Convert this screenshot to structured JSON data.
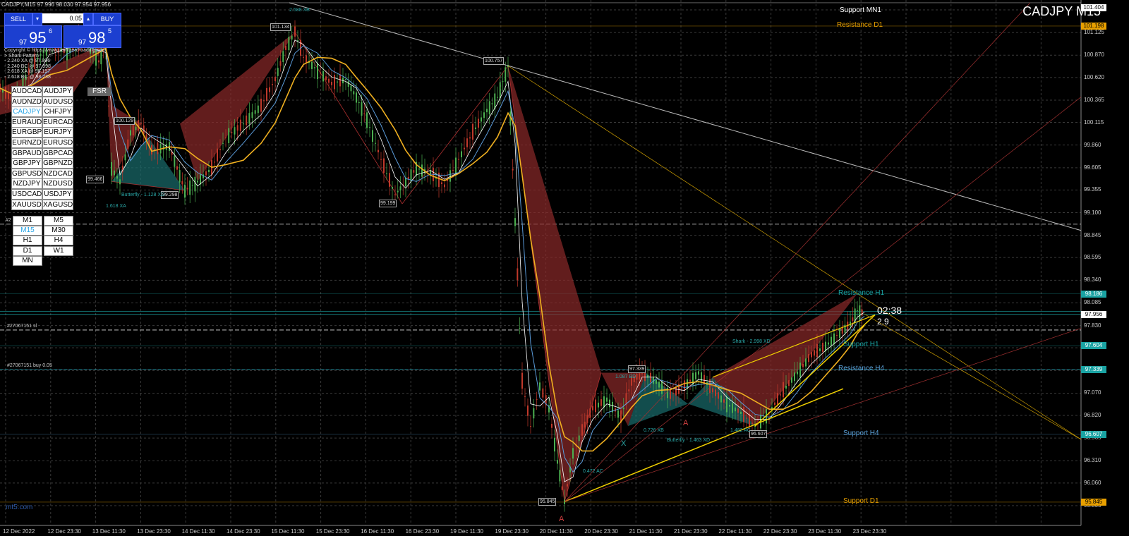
{
  "window": {
    "title": "CADJPY,M15  97.996 98.030 97.954 97.956",
    "symbol_label": "CADJPY M15"
  },
  "trade_panel": {
    "sell_label": "SELL",
    "buy_label": "BUY",
    "lot_value": "0.05",
    "bid_prefix": "97",
    "bid_main": "95",
    "bid_sup": "6",
    "ask_prefix": "97",
    "ask_main": "98",
    "ask_sup": "5"
  },
  "info_lines": [
    "Copyright © https://www.pointzero-trading.com",
    "> Shark Pattern",
    "- 2.240 XA @ 97.996",
    "- 2.240 BC @ 97.998",
    "- 2.618 XA @ 98.197",
    "- 2.618 BC @ 98.238"
  ],
  "pairs": [
    [
      "AUDCAD",
      "AUDJPY"
    ],
    [
      "AUDNZD",
      "AUDUSD"
    ],
    [
      "CADJPY",
      "CHFJPY"
    ],
    [
      "EURAUD",
      "EURCAD"
    ],
    [
      "EURGBP",
      "EURJPY"
    ],
    [
      "EURNZD",
      "EURUSD"
    ],
    [
      "GBPAUD",
      "GBPCAD"
    ],
    [
      "GBPJPY",
      "GBPNZD"
    ],
    [
      "GBPUSD",
      "NZDCAD"
    ],
    [
      "NZDJPY",
      "NZDUSD"
    ],
    [
      "USDCAD",
      "USDJPY"
    ],
    [
      "XAUUSD",
      "XAGUSD"
    ]
  ],
  "active_pair": "CADJPY",
  "fsr_label": "FSR",
  "timeframes": [
    [
      "M1",
      "M5"
    ],
    [
      "M15",
      "M30"
    ],
    [
      "H1",
      "H4"
    ],
    [
      "D1",
      "W1"
    ],
    [
      "MN"
    ]
  ],
  "active_timeframe": "M15",
  "y_axis": {
    "labels": [
      "101.380",
      "101.125",
      "100.870",
      "100.620",
      "100.365",
      "100.115",
      "99.860",
      "99.605",
      "99.355",
      "99.100",
      "98.845",
      "98.595",
      "98.340",
      "98.085",
      "97.830",
      "97.580",
      "97.325",
      "97.070",
      "96.820",
      "96.565",
      "96.310",
      "96.060",
      "95.805"
    ],
    "range": [
      95.805,
      101.46
    ]
  },
  "price_boxes": [
    {
      "value": "101.404",
      "bg": "#ffffff",
      "fg": "#000000"
    },
    {
      "value": "101.198",
      "bg": "#e8a000",
      "fg": "#000000"
    },
    {
      "value": "98.186",
      "bg": "#1aa3a3",
      "fg": "#ffffff"
    },
    {
      "value": "97.956",
      "bg": "#ffffff",
      "fg": "#000000"
    },
    {
      "value": "97.604",
      "bg": "#1aa3a3",
      "fg": "#ffffff"
    },
    {
      "value": "97.339",
      "bg": "#1aa3a3",
      "fg": "#ffffff"
    },
    {
      "value": "96.607",
      "bg": "#1aa3a3",
      "fg": "#ffffff"
    },
    {
      "value": "95.845",
      "bg": "#e8a000",
      "fg": "#000000"
    }
  ],
  "x_axis": {
    "labels": [
      "12 Dec 2022",
      "12 Dec 23:30",
      "13 Dec 11:30",
      "13 Dec 23:30",
      "14 Dec 11:30",
      "14 Dec 23:30",
      "15 Dec 11:30",
      "15 Dec 23:30",
      "16 Dec 11:30",
      "16 Dec 23:30",
      "19 Dec 11:30",
      "19 Dec 23:30",
      "20 Dec 11:30",
      "20 Dec 23:30",
      "21 Dec 11:30",
      "21 Dec 23:30",
      "22 Dec 11:30",
      "22 Dec 23:30",
      "23 Dec 11:30",
      "23 Dec 23:30"
    ]
  },
  "levels": [
    {
      "name": "Support MN1",
      "color": "#ffffff"
    },
    {
      "name": "Resistance D1",
      "color": "#e8a000"
    },
    {
      "name": "Resistance H1",
      "color": "#1aa3a3"
    },
    {
      "name": "Support H1",
      "color": "#1aa3a3"
    },
    {
      "name": "Resistance H4",
      "color": "#5aa0d8"
    },
    {
      "name": "Support H4",
      "color": "#5aa0d8"
    },
    {
      "name": "Support D1",
      "color": "#e8a000"
    }
  ],
  "order_labels": [
    "#27067151 sl",
    "#27067151 buy 0.05",
    "#2"
  ],
  "countdown": "02:38",
  "spread": "2.9",
  "pivot_labels": [
    "101.134",
    "100.757",
    "100.129",
    "99.466",
    "99.298",
    "99.199",
    "97.339",
    "96.607",
    "95.845"
  ],
  "pattern_annotations": [
    "Shark - 2.998 XD",
    "Butterfly - 1.463 XD",
    "Butterfly - 1.128 XD",
    "0.472 AC",
    "0.726 XB",
    "1.482 AC",
    "1.618 XA",
    "1.087 BD",
    "2.588 XB"
  ],
  "pattern_letters": [
    "A",
    "A",
    "X"
  ],
  "watermark": "mt5.com"
}
